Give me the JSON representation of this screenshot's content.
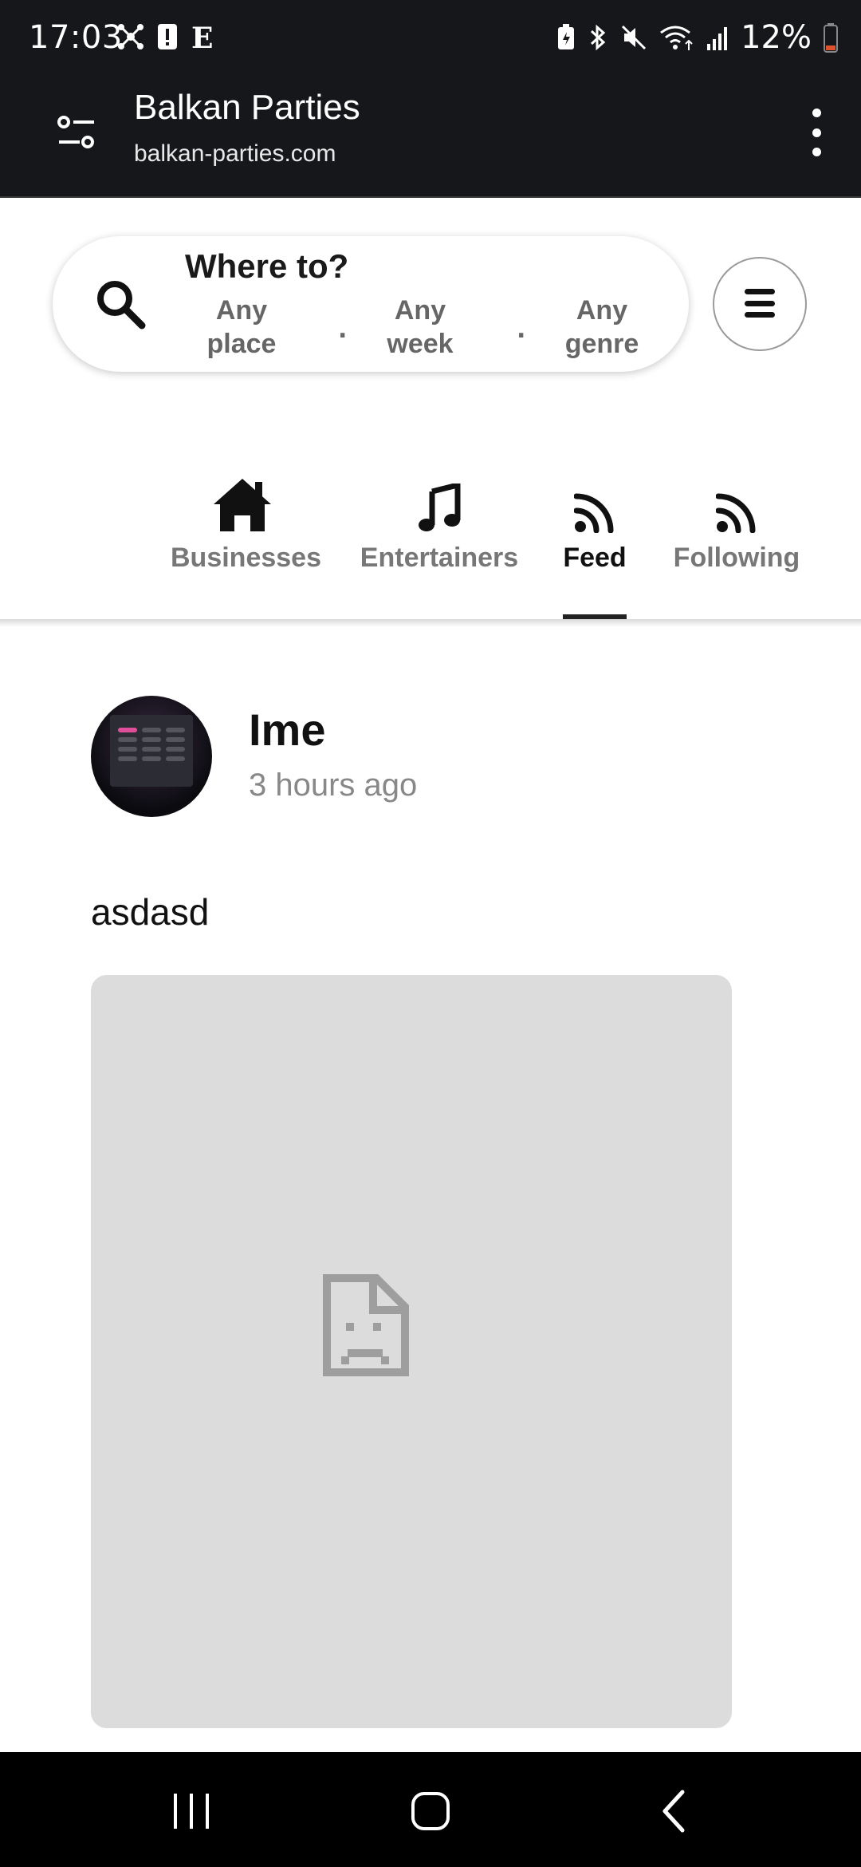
{
  "status_bar": {
    "time": "17:03",
    "battery": "12%",
    "left_icons": [
      "network-hub-icon",
      "alert-icon",
      "e-app-icon"
    ],
    "right_icons": [
      "battery-saver-icon",
      "bluetooth-icon",
      "mute-icon",
      "wifi-icon",
      "signal-icon",
      "battery-icon"
    ],
    "battery_color": "#e0522b"
  },
  "browser": {
    "title": "Balkan Parties",
    "url": "balkan-parties.com",
    "icons": [
      "tune-icon",
      "more-vert-icon"
    ]
  },
  "search": {
    "title": "Where to?",
    "options": [
      {
        "line1": "Any",
        "line2": "place"
      },
      {
        "line1": "Any",
        "line2": "week"
      },
      {
        "line1": "Any",
        "line2": "genre"
      }
    ],
    "separator": "."
  },
  "tabs": [
    {
      "label": "Businesses",
      "icon": "house-icon",
      "active": false
    },
    {
      "label": "Entertainers",
      "icon": "music-note-icon",
      "active": false
    },
    {
      "label": "Feed",
      "icon": "rss-icon",
      "active": true
    },
    {
      "label": "Following",
      "icon": "rss-icon",
      "active": false
    }
  ],
  "post": {
    "author": "Ime",
    "time": "3 hours ago",
    "text": "asdasd",
    "image_state": "broken-image-icon"
  },
  "colors": {
    "header_bg": "#16171b",
    "image_placeholder": "#dcdcdc",
    "muted_text": "#777777"
  }
}
